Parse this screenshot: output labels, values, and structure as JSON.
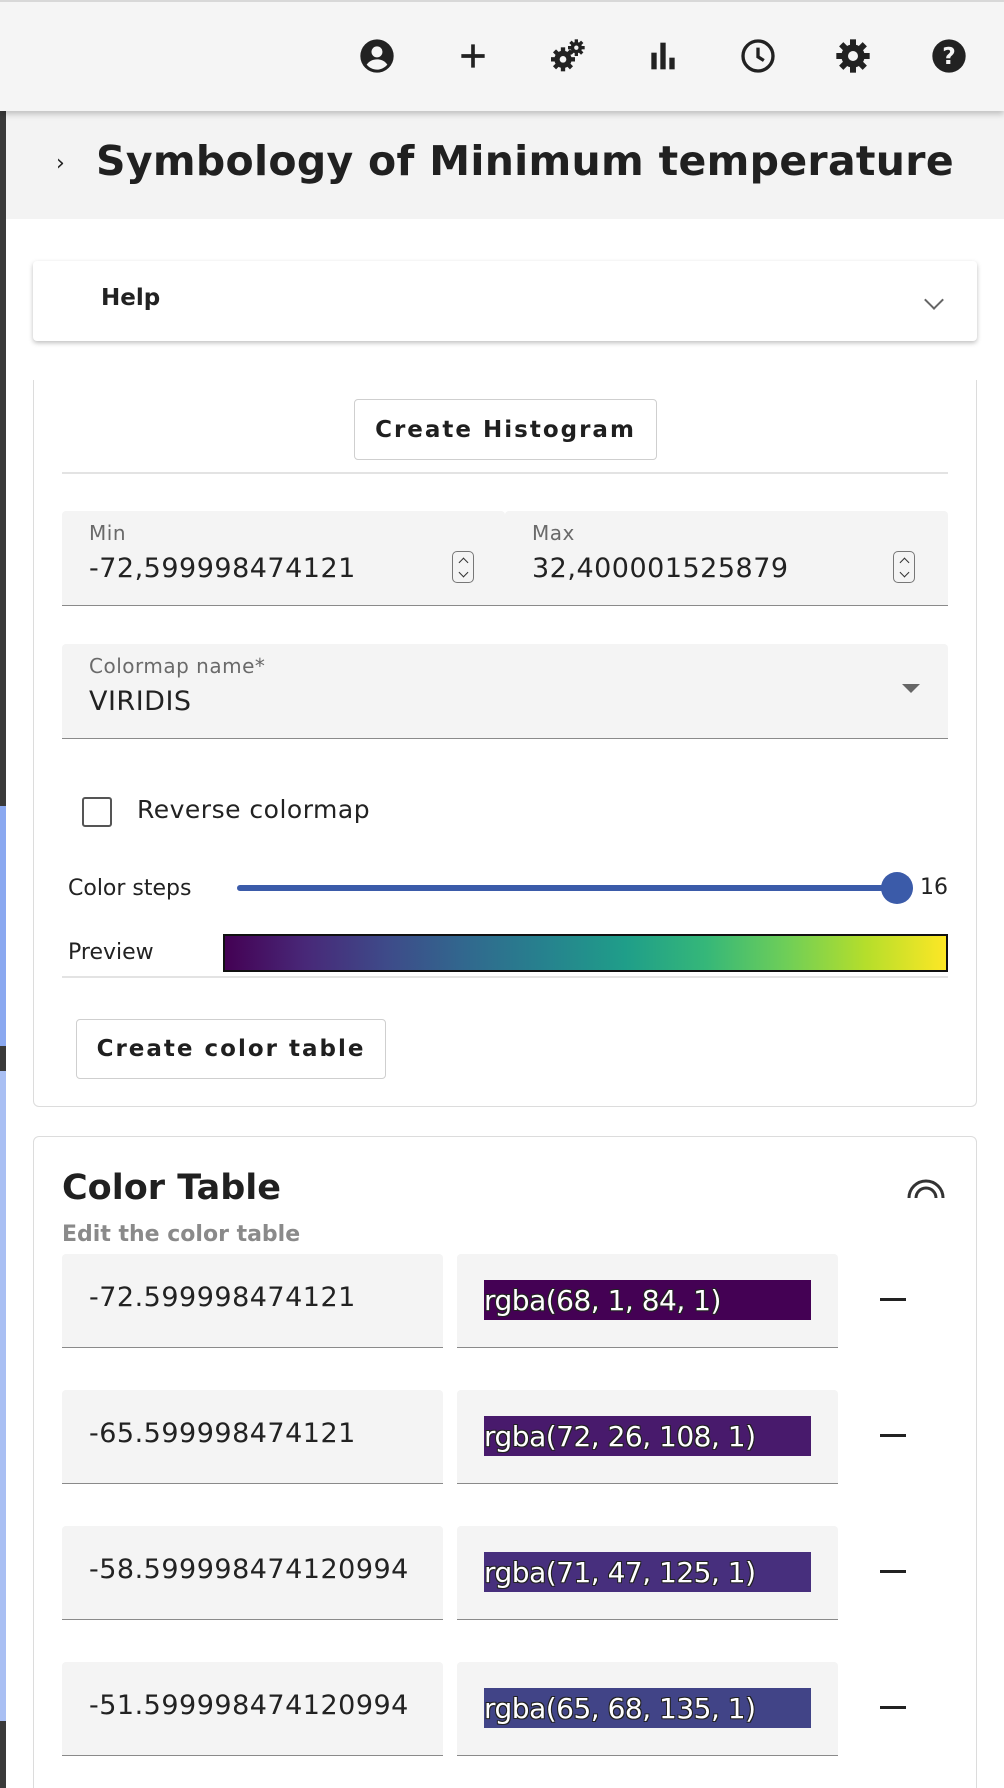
{
  "toolbar": {
    "icons": [
      "account-icon",
      "add-icon",
      "gears-icon",
      "bar-chart-icon",
      "clock-icon",
      "settings-icon",
      "help-icon"
    ]
  },
  "page": {
    "title": "Symbology of Minimum temperature"
  },
  "help": {
    "label": "Help"
  },
  "histogram": {
    "button_label": "Create Histogram"
  },
  "range": {
    "min_label": "Min",
    "min_value": "-72,599998474121",
    "max_label": "Max",
    "max_value": "32,400001525879"
  },
  "colormap": {
    "label": "Colormap name*",
    "value": "VIRIDIS"
  },
  "reverse": {
    "label": "Reverse colormap",
    "checked": false
  },
  "steps": {
    "label": "Color steps",
    "value": "16",
    "fraction": 1.0
  },
  "preview": {
    "label": "Preview",
    "colors": [
      "#440154",
      "#482878",
      "#3e4a89",
      "#31688e",
      "#26828e",
      "#1f9e89",
      "#35b779",
      "#6ece58",
      "#b5de2b",
      "#fde725"
    ]
  },
  "create_table": {
    "button_label": "Create color table"
  },
  "color_table": {
    "title": "Color Table",
    "subtitle": "Edit the color table",
    "rows": [
      {
        "value": "-72.599998474121",
        "color": "rgba(68, 1, 84, 1)"
      },
      {
        "value": "-65.599998474121",
        "color": "rgba(72, 26, 108, 1)"
      },
      {
        "value": "-58.599998474120994",
        "color": "rgba(71, 47, 125, 1)"
      },
      {
        "value": "-51.599998474120994",
        "color": "rgba(65, 68, 135, 1)"
      }
    ]
  },
  "colors": {
    "accent": "#3b5ba9",
    "field_bg": "#f4f4f4"
  }
}
